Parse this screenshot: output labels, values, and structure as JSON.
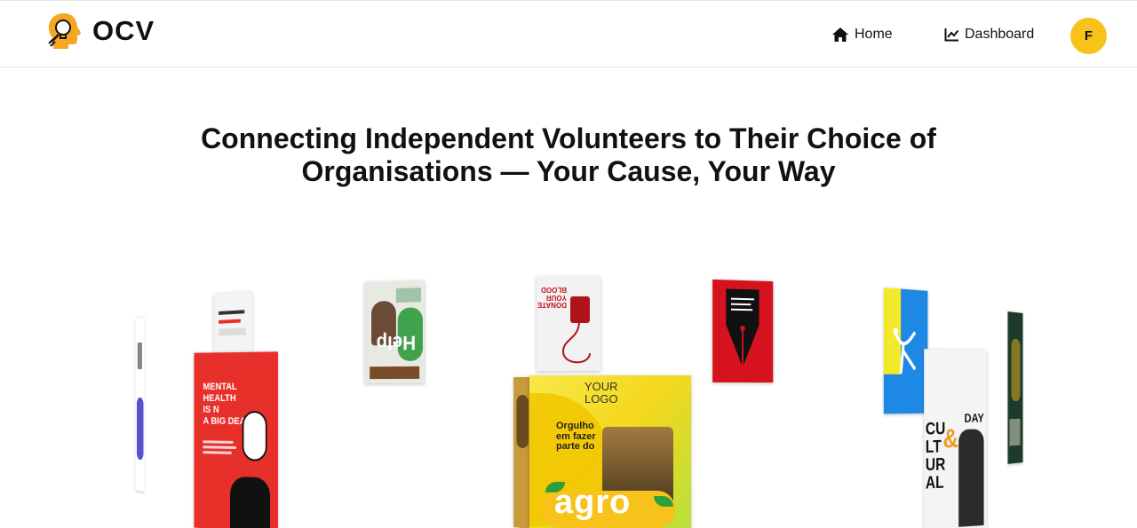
{
  "header": {
    "brand": "OCV",
    "nav": {
      "home_label": "Home",
      "dashboard_label": "Dashboard"
    },
    "avatar_initial": "F"
  },
  "hero": {
    "title": "Connecting Independent Volunteers to Their Choice of Organisations — Your Cause, Your Way"
  },
  "gallery": {
    "mental_health": {
      "line1": "MENTAL",
      "line2": "HEALTH",
      "line3": "IS N",
      "line4": "A BIG DEAL"
    },
    "help_poster": {
      "word": "Help"
    },
    "donate_poster": {
      "text": "DONATE YOUR BLOOD"
    },
    "agro_poster": {
      "logo": "YOUR LOGO",
      "headline": "Orgulho em fazer parte do",
      "word": "agro"
    },
    "cultural_poster": {
      "line1": "CU",
      "line2": "LT",
      "line3": "UR",
      "line4": "AL",
      "day": "DAY"
    }
  },
  "colors": {
    "accent": "#f7c21a",
    "logo_orange": "#f5a623",
    "poster_red": "#e8302b"
  }
}
